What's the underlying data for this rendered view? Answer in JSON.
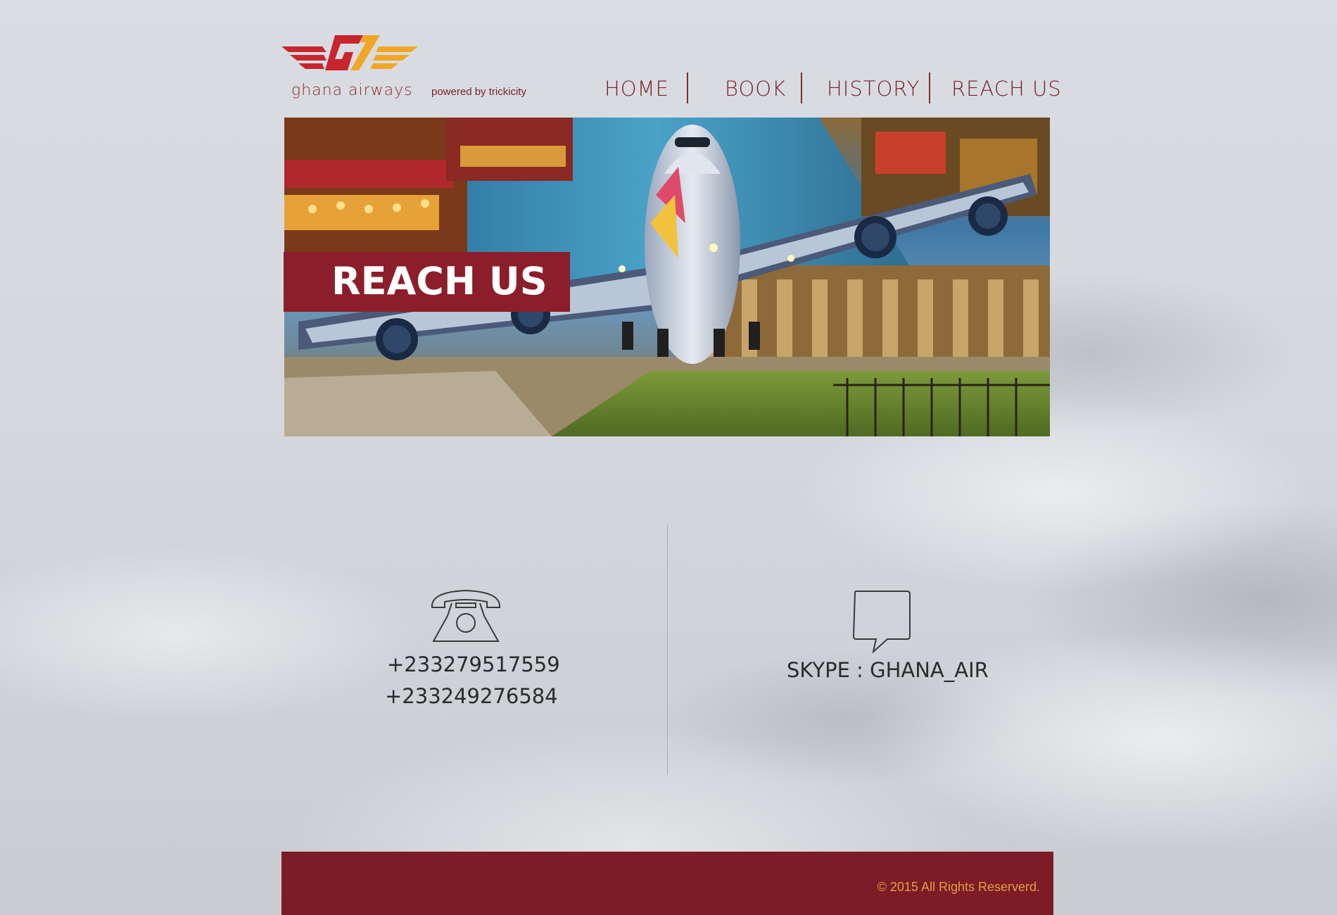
{
  "header": {
    "logo_text": "ghana airways",
    "powered_by": "powered by trickicity"
  },
  "nav": {
    "items": [
      {
        "label": "HOME"
      },
      {
        "label": "BOOK"
      },
      {
        "label": "HISTORY"
      },
      {
        "label": "REACH US"
      }
    ]
  },
  "hero": {
    "badge_label": "REACH US"
  },
  "contact": {
    "phones": [
      "+233279517559",
      "+233249276584"
    ],
    "skype": "SKYPE : GHANA_AIR"
  },
  "footer": {
    "copyright": "©  2015 All Rights Reserverd."
  },
  "colors": {
    "brand_red": "#8b1e2a",
    "footer_bg": "#7d1b26",
    "accent_gold": "#e0a040"
  },
  "icons": {
    "logo": "ghana-airways-logo",
    "phone": "telephone-icon",
    "chat": "speech-bubble-icon"
  }
}
